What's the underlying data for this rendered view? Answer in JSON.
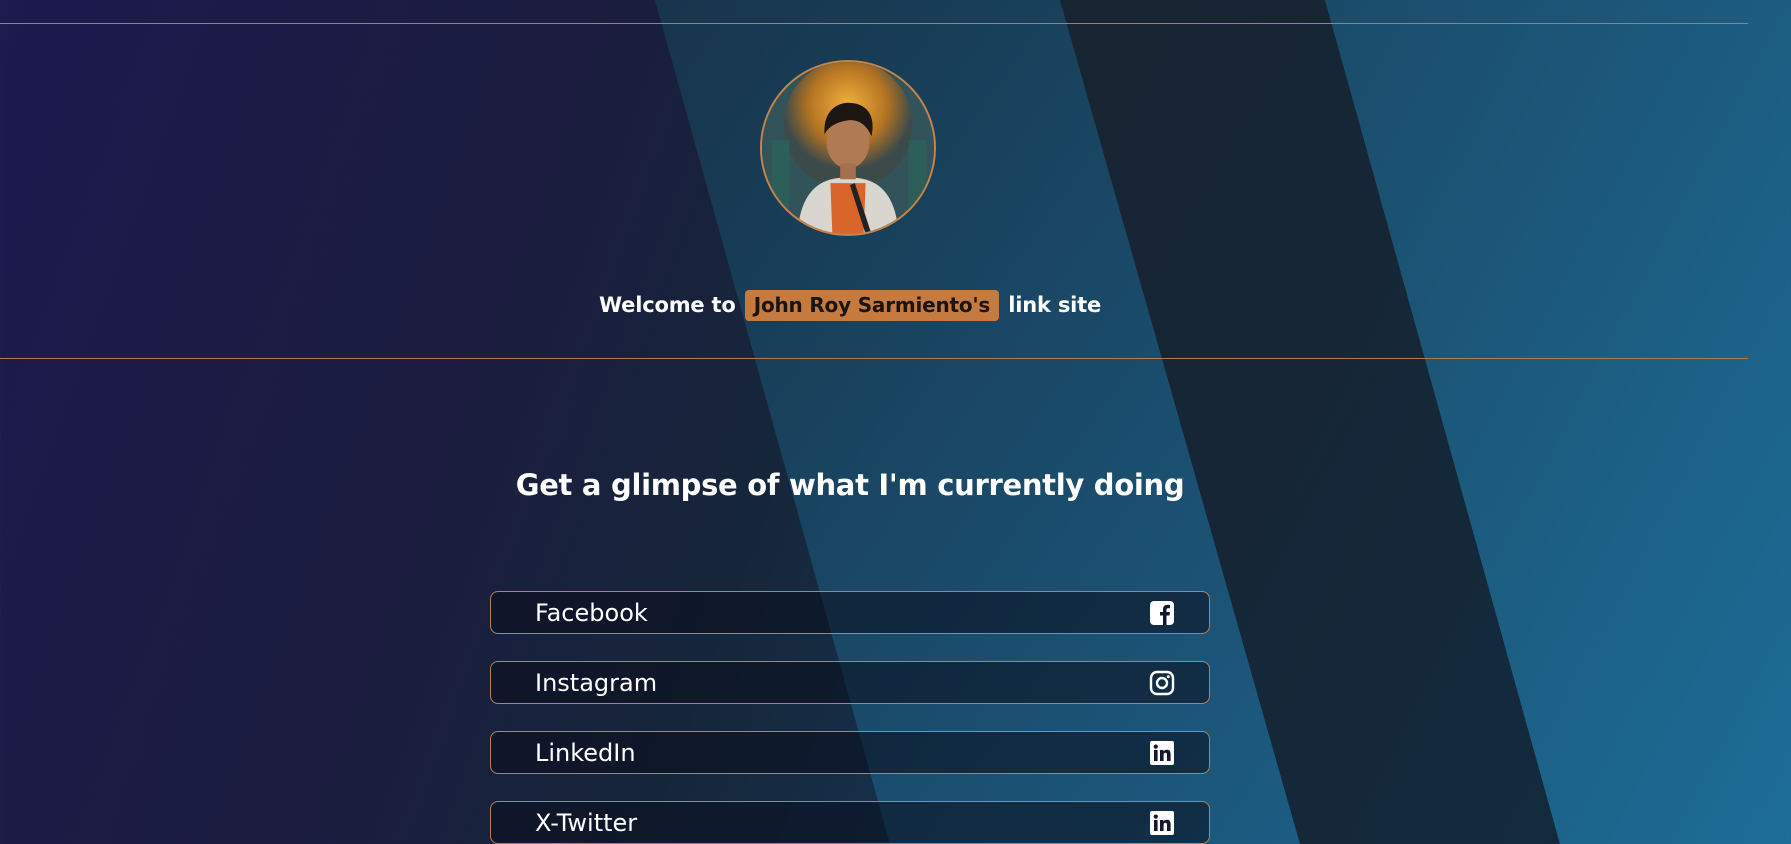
{
  "welcome": {
    "prefix": "Welcome to",
    "name": "John Roy Sarmiento's",
    "suffix": "link site"
  },
  "subtitle": "Get a glimpse of what I'm currently doing",
  "links": [
    {
      "label": "Facebook",
      "icon": "facebook-icon"
    },
    {
      "label": "Instagram",
      "icon": "instagram-icon"
    },
    {
      "label": "LinkedIn",
      "icon": "linkedin-icon"
    },
    {
      "label": "X-Twitter",
      "icon": "linkedin-icon"
    }
  ],
  "colors": {
    "accent": "#c57a3f",
    "border": "#b98056",
    "text": "#ffffff"
  }
}
